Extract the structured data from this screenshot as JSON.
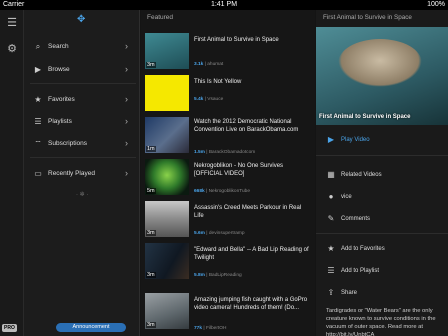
{
  "status": {
    "carrier": "Carrier",
    "time": "1:41 PM",
    "battery": "100%"
  },
  "rail": {
    "pro_label": "PRO"
  },
  "sidebar": {
    "items": [
      {
        "icon": "⌕",
        "label": "Search"
      },
      {
        "icon": "▶",
        "label": "Browse"
      },
      {
        "icon": "★",
        "label": "Favorites"
      },
      {
        "icon": "☰",
        "label": "Playlists"
      },
      {
        "icon": "⌔",
        "label": "Subscriptions"
      },
      {
        "icon": "▭",
        "label": "Recently Played"
      }
    ],
    "announcement_label": "Announcement"
  },
  "feed": {
    "title": "Featured",
    "videos": [
      {
        "title": "First Animal to Survive in Space",
        "duration": "3m",
        "views": "3.1k",
        "channel": "ahumat"
      },
      {
        "title": "This Is Not Yellow",
        "duration": "",
        "views": "5.4k",
        "channel": "Vsauce"
      },
      {
        "title": "Watch the 2012 Democratic National Convention Live on BarackObama.com",
        "duration": "1m",
        "views": "1.5m",
        "channel": "BarackObamadotcom"
      },
      {
        "title": "Nekrogoblikon - No One Survives [OFFICIAL VIDEO]",
        "duration": "5m",
        "views": "668k",
        "channel": "NekrogoblikonTube"
      },
      {
        "title": "Assassin's Creed Meets Parkour in Real Life",
        "duration": "3m",
        "views": "5.6m",
        "channel": "devinsupertramp"
      },
      {
        "title": "\"Edward and Bella\" -- A Bad Lip Reading of Twilight",
        "duration": "3m",
        "views": "5.8m",
        "channel": "BadLipReading"
      },
      {
        "title": "Amazing jumping fish caught with a GoPro video camera! Hundreds of them! (Do...",
        "duration": "3m",
        "views": "77k",
        "channel": "FilbertOH"
      }
    ]
  },
  "detail": {
    "title": "First Animal to Survive in Space",
    "hero_caption": "First Animal to Survive in Space",
    "actions": [
      {
        "icon": "▶",
        "label": "Play Video"
      },
      {
        "icon": "▦",
        "label": "Related Videos"
      },
      {
        "icon": "●",
        "label": "vice"
      },
      {
        "icon": "✎",
        "label": "Comments"
      },
      {
        "icon": "★",
        "label": "Add to Favorites"
      },
      {
        "icon": "☰",
        "label": "Add to Playlist"
      },
      {
        "icon": "⇪",
        "label": "Share"
      }
    ],
    "description": "Tardigrades or \"Water Bears\" are the only creature known to survive conditions in the vacuum of outer space. Read more at http://bit.ly/UnbtCA"
  },
  "colors": {
    "accent": "#4aa3e8",
    "yellow_thumb": "#f5e800",
    "announce_bg": "#2a6fb5"
  }
}
